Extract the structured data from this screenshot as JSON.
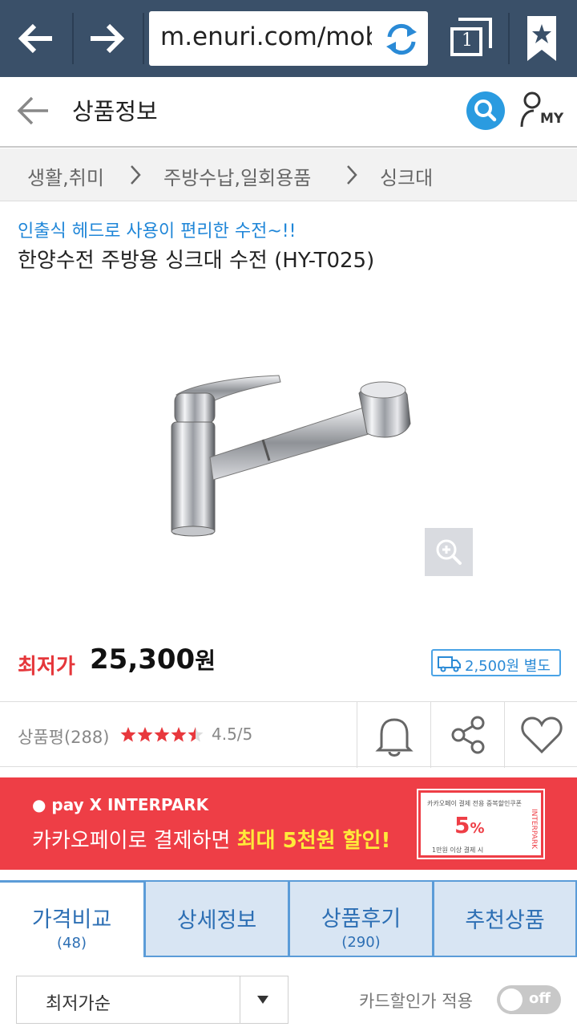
{
  "browser": {
    "url": "m.enuri.com/mobile/detail.jsp",
    "tab_count": "1"
  },
  "header": {
    "title": "상품정보",
    "my_label": "MY"
  },
  "breadcrumb": [
    "생활,취미",
    "주방수납,일회용품",
    "싱크대"
  ],
  "product": {
    "subtitle": "인출식 헤드로 사용이 편리한 수전~!!",
    "name": "한양수전 주방용 싱크대 수전 (HY-T025)",
    "price_label": "최저가",
    "price_value": "25,300",
    "price_unit": "원",
    "shipping": "2,500원 별도",
    "review_label": "상품평(288)",
    "rating": 4.5,
    "rating_text": "4.5/5"
  },
  "banner": {
    "pay_line": "● pay  X INTERPARK",
    "text_prefix": "카카오페이로 결제하면 ",
    "text_highlight": "최대 5천원 할인!",
    "coupon_top": "카카오페이 결제 전용 중복할인쿠폰",
    "coupon_pct": "5",
    "coupon_pct_sign": "%",
    "coupon_bottom": "1만원 이상 결제 시",
    "coupon_brand": "INTERPARK"
  },
  "tabs": [
    {
      "label": "가격비교",
      "count": "(48)"
    },
    {
      "label": "상세정보",
      "count": ""
    },
    {
      "label": "상품후기",
      "count": "(290)"
    },
    {
      "label": "추천상품",
      "count": ""
    }
  ],
  "sort": {
    "selected": "최저가순",
    "card_discount_label": "카드할인가 적용",
    "toggle_state": "off"
  },
  "colors": {
    "browser_bar": "#3a5069",
    "accent_blue": "#2a9be0",
    "price_red": "#e5373b",
    "banner_red": "#ee3e46",
    "highlight_yellow": "#ffea3a"
  }
}
